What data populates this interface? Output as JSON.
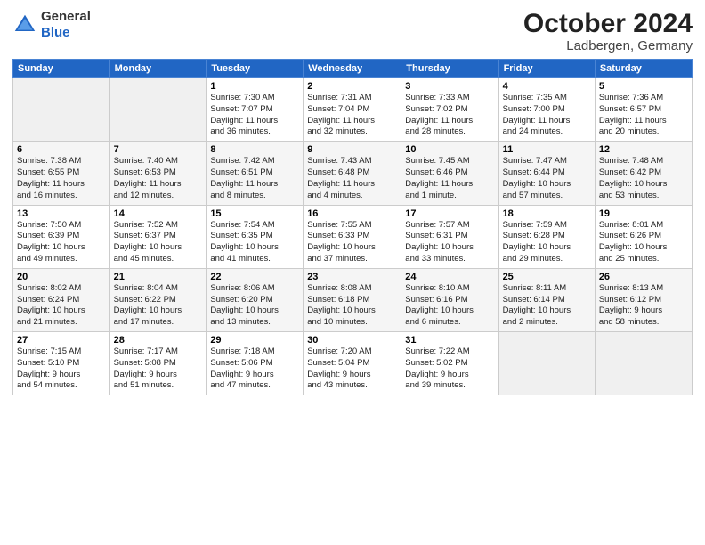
{
  "header": {
    "logo": {
      "general": "General",
      "blue": "Blue"
    },
    "title": "October 2024",
    "subtitle": "Ladbergen, Germany"
  },
  "days_of_week": [
    "Sunday",
    "Monday",
    "Tuesday",
    "Wednesday",
    "Thursday",
    "Friday",
    "Saturday"
  ],
  "weeks": [
    [
      {
        "day": "",
        "detail": ""
      },
      {
        "day": "",
        "detail": ""
      },
      {
        "day": "1",
        "detail": "Sunrise: 7:30 AM\nSunset: 7:07 PM\nDaylight: 11 hours\nand 36 minutes."
      },
      {
        "day": "2",
        "detail": "Sunrise: 7:31 AM\nSunset: 7:04 PM\nDaylight: 11 hours\nand 32 minutes."
      },
      {
        "day": "3",
        "detail": "Sunrise: 7:33 AM\nSunset: 7:02 PM\nDaylight: 11 hours\nand 28 minutes."
      },
      {
        "day": "4",
        "detail": "Sunrise: 7:35 AM\nSunset: 7:00 PM\nDaylight: 11 hours\nand 24 minutes."
      },
      {
        "day": "5",
        "detail": "Sunrise: 7:36 AM\nSunset: 6:57 PM\nDaylight: 11 hours\nand 20 minutes."
      }
    ],
    [
      {
        "day": "6",
        "detail": "Sunrise: 7:38 AM\nSunset: 6:55 PM\nDaylight: 11 hours\nand 16 minutes."
      },
      {
        "day": "7",
        "detail": "Sunrise: 7:40 AM\nSunset: 6:53 PM\nDaylight: 11 hours\nand 12 minutes."
      },
      {
        "day": "8",
        "detail": "Sunrise: 7:42 AM\nSunset: 6:51 PM\nDaylight: 11 hours\nand 8 minutes."
      },
      {
        "day": "9",
        "detail": "Sunrise: 7:43 AM\nSunset: 6:48 PM\nDaylight: 11 hours\nand 4 minutes."
      },
      {
        "day": "10",
        "detail": "Sunrise: 7:45 AM\nSunset: 6:46 PM\nDaylight: 11 hours\nand 1 minute."
      },
      {
        "day": "11",
        "detail": "Sunrise: 7:47 AM\nSunset: 6:44 PM\nDaylight: 10 hours\nand 57 minutes."
      },
      {
        "day": "12",
        "detail": "Sunrise: 7:48 AM\nSunset: 6:42 PM\nDaylight: 10 hours\nand 53 minutes."
      }
    ],
    [
      {
        "day": "13",
        "detail": "Sunrise: 7:50 AM\nSunset: 6:39 PM\nDaylight: 10 hours\nand 49 minutes."
      },
      {
        "day": "14",
        "detail": "Sunrise: 7:52 AM\nSunset: 6:37 PM\nDaylight: 10 hours\nand 45 minutes."
      },
      {
        "day": "15",
        "detail": "Sunrise: 7:54 AM\nSunset: 6:35 PM\nDaylight: 10 hours\nand 41 minutes."
      },
      {
        "day": "16",
        "detail": "Sunrise: 7:55 AM\nSunset: 6:33 PM\nDaylight: 10 hours\nand 37 minutes."
      },
      {
        "day": "17",
        "detail": "Sunrise: 7:57 AM\nSunset: 6:31 PM\nDaylight: 10 hours\nand 33 minutes."
      },
      {
        "day": "18",
        "detail": "Sunrise: 7:59 AM\nSunset: 6:28 PM\nDaylight: 10 hours\nand 29 minutes."
      },
      {
        "day": "19",
        "detail": "Sunrise: 8:01 AM\nSunset: 6:26 PM\nDaylight: 10 hours\nand 25 minutes."
      }
    ],
    [
      {
        "day": "20",
        "detail": "Sunrise: 8:02 AM\nSunset: 6:24 PM\nDaylight: 10 hours\nand 21 minutes."
      },
      {
        "day": "21",
        "detail": "Sunrise: 8:04 AM\nSunset: 6:22 PM\nDaylight: 10 hours\nand 17 minutes."
      },
      {
        "day": "22",
        "detail": "Sunrise: 8:06 AM\nSunset: 6:20 PM\nDaylight: 10 hours\nand 13 minutes."
      },
      {
        "day": "23",
        "detail": "Sunrise: 8:08 AM\nSunset: 6:18 PM\nDaylight: 10 hours\nand 10 minutes."
      },
      {
        "day": "24",
        "detail": "Sunrise: 8:10 AM\nSunset: 6:16 PM\nDaylight: 10 hours\nand 6 minutes."
      },
      {
        "day": "25",
        "detail": "Sunrise: 8:11 AM\nSunset: 6:14 PM\nDaylight: 10 hours\nand 2 minutes."
      },
      {
        "day": "26",
        "detail": "Sunrise: 8:13 AM\nSunset: 6:12 PM\nDaylight: 9 hours\nand 58 minutes."
      }
    ],
    [
      {
        "day": "27",
        "detail": "Sunrise: 7:15 AM\nSunset: 5:10 PM\nDaylight: 9 hours\nand 54 minutes."
      },
      {
        "day": "28",
        "detail": "Sunrise: 7:17 AM\nSunset: 5:08 PM\nDaylight: 9 hours\nand 51 minutes."
      },
      {
        "day": "29",
        "detail": "Sunrise: 7:18 AM\nSunset: 5:06 PM\nDaylight: 9 hours\nand 47 minutes."
      },
      {
        "day": "30",
        "detail": "Sunrise: 7:20 AM\nSunset: 5:04 PM\nDaylight: 9 hours\nand 43 minutes."
      },
      {
        "day": "31",
        "detail": "Sunrise: 7:22 AM\nSunset: 5:02 PM\nDaylight: 9 hours\nand 39 minutes."
      },
      {
        "day": "",
        "detail": ""
      },
      {
        "day": "",
        "detail": ""
      }
    ]
  ]
}
